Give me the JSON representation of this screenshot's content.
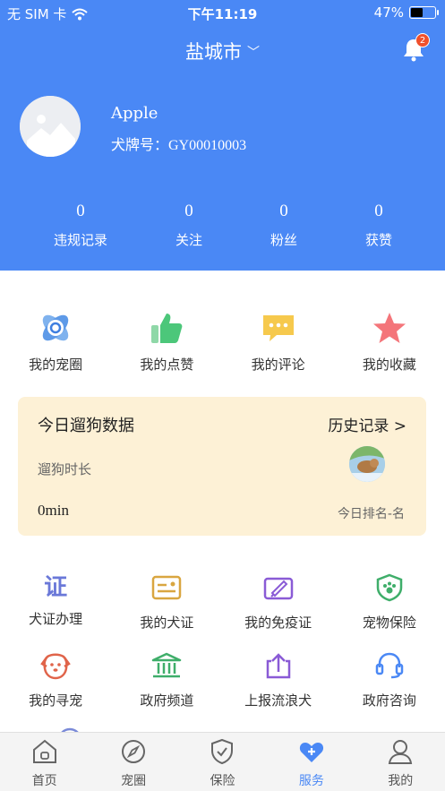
{
  "status_bar": {
    "carrier": "无 SIM 卡",
    "time": "下午11:19",
    "battery": "47%",
    "battery_level": 0.47
  },
  "header": {
    "city": "盐城市",
    "notification_count": "2"
  },
  "profile": {
    "name": "Apple",
    "tag": "犬牌号：GY00010003"
  },
  "stats": [
    {
      "value": "0",
      "label": "违规记录"
    },
    {
      "value": "0",
      "label": "关注"
    },
    {
      "value": "0",
      "label": "粉丝"
    },
    {
      "value": "0",
      "label": "获赞"
    }
  ],
  "quick_actions": [
    {
      "label": "我的宠圈",
      "icon": "pet-circle-icon"
    },
    {
      "label": "我的点赞",
      "icon": "thumbs-up-icon"
    },
    {
      "label": "我的评论",
      "icon": "comment-icon"
    },
    {
      "label": "我的收藏",
      "icon": "star-icon"
    }
  ],
  "walk": {
    "title": "今日遛狗数据",
    "history": "历史记录 >",
    "duration_label": "遛狗时长",
    "duration_value": "0min",
    "rank": "今日排名-名"
  },
  "services": [
    {
      "label": "犬证办理",
      "icon": "certificate-text-icon",
      "glyph": "证"
    },
    {
      "label": "我的犬证",
      "icon": "id-card-icon"
    },
    {
      "label": "我的免疫证",
      "icon": "vaccine-icon"
    },
    {
      "label": "宠物保险",
      "icon": "shield-paw-icon"
    },
    {
      "label": "我的寻宠",
      "icon": "dog-face-icon"
    },
    {
      "label": "政府频道",
      "icon": "government-building-icon"
    },
    {
      "label": "上报流浪犬",
      "icon": "upload-icon"
    },
    {
      "label": "政府咨询",
      "icon": "headset-icon"
    }
  ],
  "tabs": [
    {
      "label": "首页",
      "icon": "home-icon",
      "active": false
    },
    {
      "label": "宠圈",
      "icon": "compass-icon",
      "active": false
    },
    {
      "label": "保险",
      "icon": "shield-check-icon",
      "active": false
    },
    {
      "label": "服务",
      "icon": "heart-plus-icon",
      "active": true
    },
    {
      "label": "我的",
      "icon": "profile-icon",
      "active": false
    }
  ],
  "colors": {
    "primary": "#4a88f5",
    "card_bg": "#fdf1d6",
    "badge": "#f0502c"
  }
}
